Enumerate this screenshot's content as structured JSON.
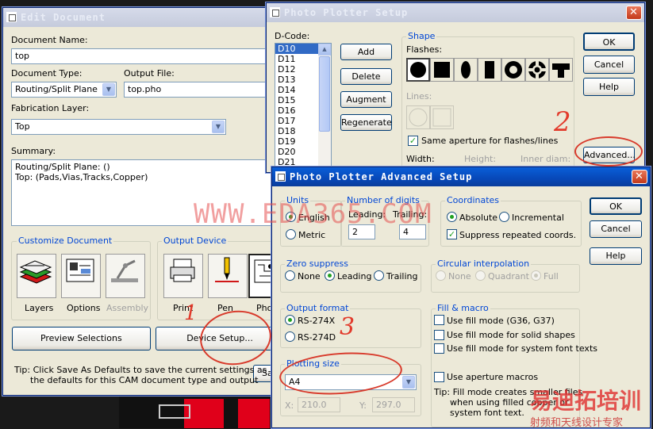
{
  "edit_doc": {
    "title": "Edit Document",
    "doc_name_label": "Document Name:",
    "doc_name_value": "top",
    "doc_type_label": "Document Type:",
    "doc_type_value": "Routing/Split Plane",
    "output_file_label": "Output File:",
    "output_file_value": "top.pho",
    "fab_layer_label": "Fabrication Layer:",
    "fab_layer_value": "Top",
    "summary_label": "Summary:",
    "summary_line1": "Routing/Split Plane: ()",
    "summary_line2": "Top: (Pads,Vias,Tracks,Copper)",
    "customize_label": "Customize Document",
    "output_device_label": "Output Device",
    "tile_layers": "Layers",
    "tile_options": "Options",
    "tile_assembly": "Assembly",
    "tile_print": "Print",
    "tile_pen": "Pen",
    "tile_photo": "Pho",
    "preview_button": "Preview Selections",
    "device_setup_button": "Device Setup...",
    "save_button": "Sa",
    "tip_line1": "Tip: Click Save As Defaults to save the current settings as",
    "tip_line2": "the defaults for this CAM document type and output"
  },
  "photo_setup": {
    "title": "Photo Plotter Setup",
    "dcode_label": "D-Code:",
    "dcodes": [
      "D10",
      "D11",
      "D12",
      "D13",
      "D14",
      "D15",
      "D16",
      "D17",
      "D18",
      "D19",
      "D20",
      "D21"
    ],
    "add_button": "Add",
    "delete_button": "Delete",
    "augment_button": "Augment",
    "regenerate_button": "Regenerate",
    "shape_label": "Shape",
    "flashes_label": "Flashes:",
    "lines_label": "Lines:",
    "same_aperture_label": "Same aperture for flashes/lines",
    "width_label": "Width:",
    "height_label": "Height:",
    "inner_diam_label": "Inner diam:",
    "ok_button": "OK",
    "cancel_button": "Cancel",
    "help_button": "Help",
    "advanced_button": "Advanced..."
  },
  "advanced": {
    "title": "Photo Plotter Advanced Setup",
    "units_label": "Units",
    "english": "English",
    "metric": "Metric",
    "digits_label": "Number of digits",
    "leading_label": "Leading:",
    "trailing_label": "Trailing:",
    "leading_value": "2",
    "trailing_value": "4",
    "coords_label": "Coordinates",
    "absolute": "Absolute",
    "incremental": "Incremental",
    "suppress_coords": "Suppress repeated coords.",
    "ok_button": "OK",
    "cancel_button": "Cancel",
    "help_button": "Help",
    "zero_label": "Zero suppress",
    "none": "None",
    "leading": "Leading",
    "trailing": "Trailing",
    "circ_label": "Circular interpolation",
    "circ_none": "None",
    "quadrant": "Quadrant",
    "full": "Full",
    "format_label": "Output format",
    "rs274x": "RS-274X",
    "rs274d": "RS-274D",
    "fill_label": "Fill & macro",
    "fill_g36": "Use fill mode (G36, G37)",
    "fill_solid": "Use fill mode for solid shapes",
    "fill_font": "Use fill mode for system font texts",
    "aperture_macros": "Use aperture macros",
    "plot_size_label": "Plotting size",
    "plot_size_value": "A4",
    "x_label": "X:",
    "x_value": "210.0",
    "y_label": "Y:",
    "y_value": "297.0",
    "tip_line1": "Tip: Fill mode creates smaller files",
    "tip_line2": "when using filled copper or",
    "tip_line3": "system font text."
  },
  "annotations": {
    "num1": "1",
    "num2": "2",
    "num3": "3",
    "watermark": "WWW.EDA365.COM",
    "logo_main": "易迪拓培训",
    "logo_sub": "射频和天线设计专家"
  }
}
